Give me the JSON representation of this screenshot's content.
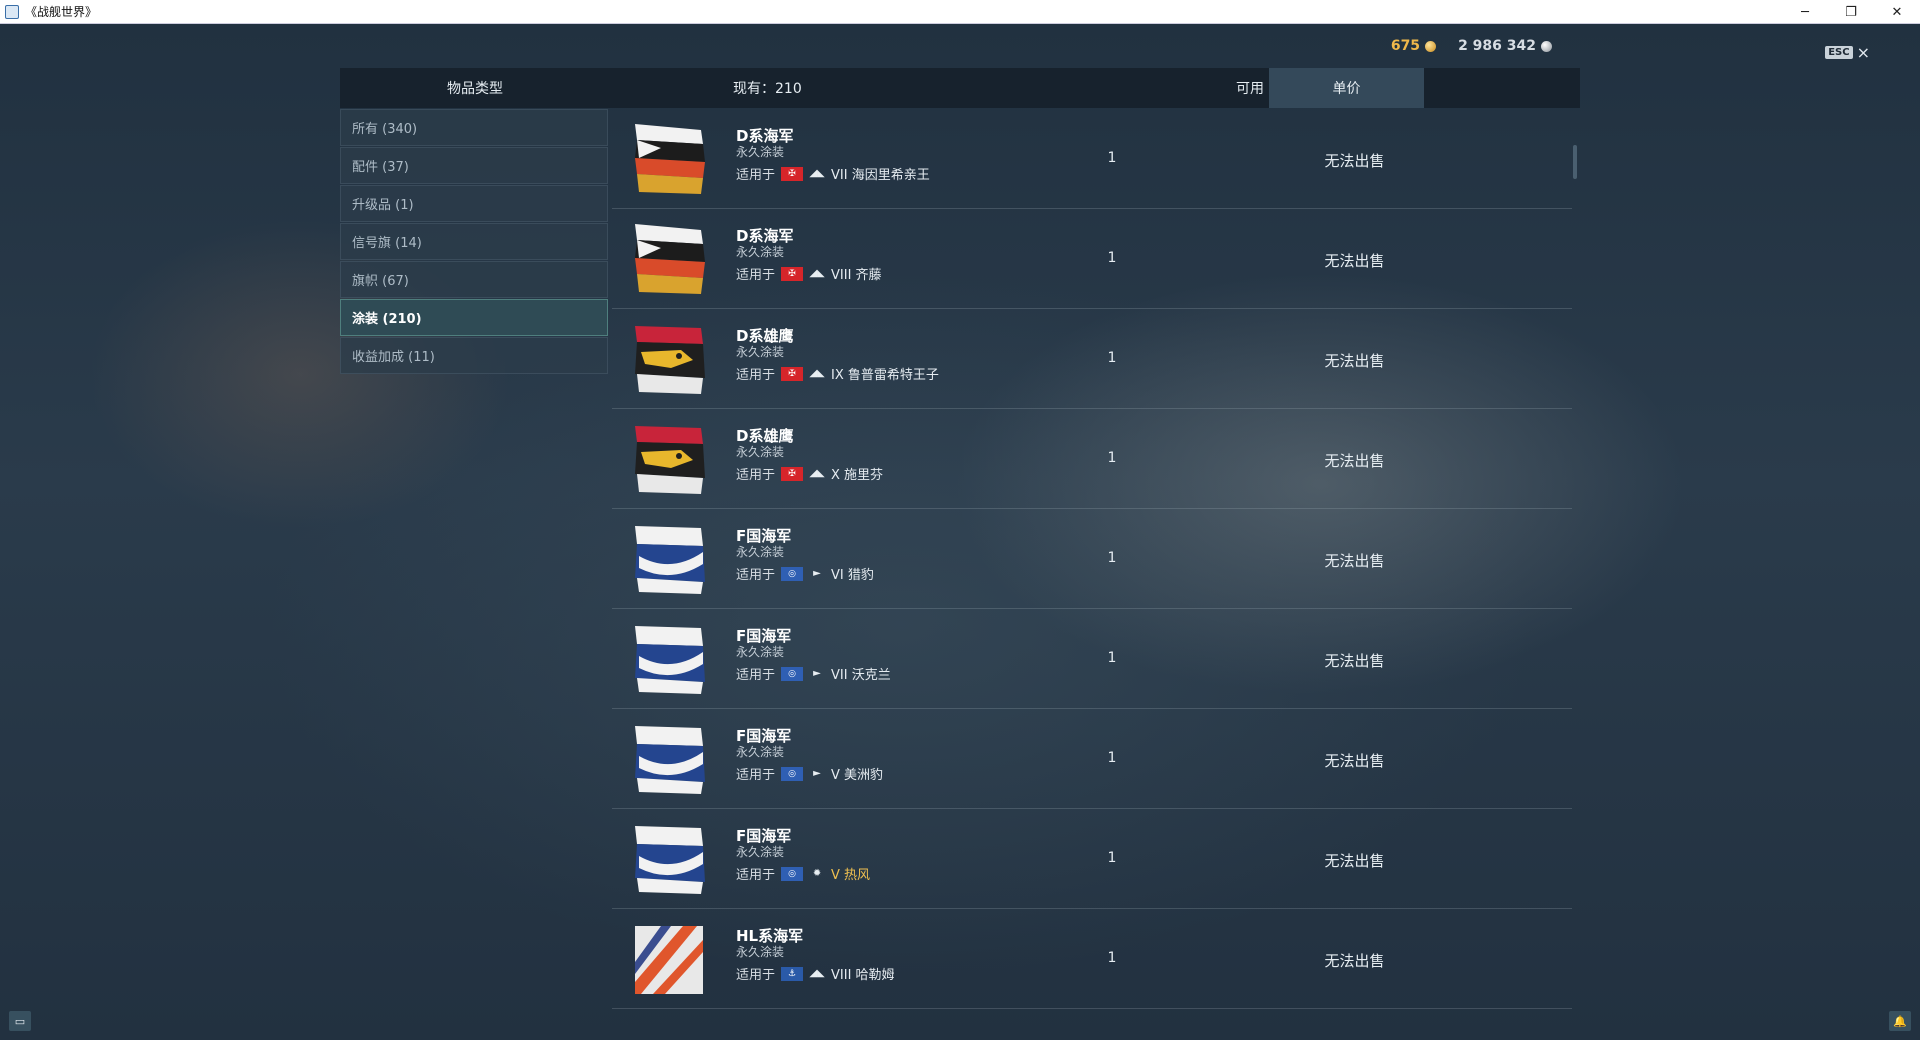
{
  "window": {
    "title": "《战舰世界》"
  },
  "currency": {
    "gold": "675",
    "credits": "2 986 342"
  },
  "esc": {
    "key": "ESC",
    "close": "×"
  },
  "header": {
    "type_label": "物品类型",
    "count_label": "现有：210",
    "available_label": "可用",
    "price_label": "单价"
  },
  "sidebar": {
    "items": [
      {
        "label": "所有 (340)",
        "active": false
      },
      {
        "label": "配件 (37)",
        "active": false
      },
      {
        "label": "升级品 (1)",
        "active": false
      },
      {
        "label": "信号旗 (14)",
        "active": false
      },
      {
        "label": "旗帜 (67)",
        "active": false
      },
      {
        "label": "涂装 (210)",
        "active": true
      },
      {
        "label": "收益加成 (11)",
        "active": false
      }
    ]
  },
  "items": [
    {
      "name": "D系海军",
      "type": "永久涂装",
      "applies_label": "适用于",
      "nation": "de",
      "class_icon": "battleship-icon",
      "ship": "VII 海因里希亲王",
      "premium": false,
      "qty": "1",
      "price": "无法出售",
      "thumb": "d-navy"
    },
    {
      "name": "D系海军",
      "type": "永久涂装",
      "applies_label": "适用于",
      "nation": "de",
      "class_icon": "battleship-icon",
      "ship": "VIII 齐藤",
      "premium": false,
      "qty": "1",
      "price": "无法出售",
      "thumb": "d-navy"
    },
    {
      "name": "D系雄鹰",
      "type": "永久涂装",
      "applies_label": "适用于",
      "nation": "de",
      "class_icon": "battleship-icon",
      "ship": "IX 鲁普雷希特王子",
      "premium": false,
      "qty": "1",
      "price": "无法出售",
      "thumb": "d-eagle"
    },
    {
      "name": "D系雄鹰",
      "type": "永久涂装",
      "applies_label": "适用于",
      "nation": "de",
      "class_icon": "battleship-icon",
      "ship": "X 施里芬",
      "premium": false,
      "qty": "1",
      "price": "无法出售",
      "thumb": "d-eagle"
    },
    {
      "name": "F国海军",
      "type": "永久涂装",
      "applies_label": "适用于",
      "nation": "fr",
      "class_icon": "destroyer-icon",
      "ship": "VI 猎豹",
      "premium": false,
      "qty": "1",
      "price": "无法出售",
      "thumb": "f-navy"
    },
    {
      "name": "F国海军",
      "type": "永久涂装",
      "applies_label": "适用于",
      "nation": "fr",
      "class_icon": "destroyer-icon",
      "ship": "VII 沃克兰",
      "premium": false,
      "qty": "1",
      "price": "无法出售",
      "thumb": "f-navy"
    },
    {
      "name": "F国海军",
      "type": "永久涂装",
      "applies_label": "适用于",
      "nation": "fr",
      "class_icon": "destroyer-icon",
      "ship": "V 美洲豹",
      "premium": false,
      "qty": "1",
      "price": "无法出售",
      "thumb": "f-navy"
    },
    {
      "name": "F国海军",
      "type": "永久涂装",
      "applies_label": "适用于",
      "nation": "fr",
      "class_icon": "premium-destroyer-icon",
      "ship": "V 热风",
      "premium": true,
      "qty": "1",
      "price": "无法出售",
      "thumb": "f-navy"
    },
    {
      "name": "HL系海军",
      "type": "永久涂装",
      "applies_label": "适用于",
      "nation": "nl",
      "class_icon": "battleship-icon",
      "ship": "VIII 哈勒姆",
      "premium": false,
      "qty": "1",
      "price": "无法出售",
      "thumb": "hl-navy"
    }
  ],
  "bottom": {
    "chat_icon": "chat-icon",
    "bell_icon": "bell-icon"
  }
}
